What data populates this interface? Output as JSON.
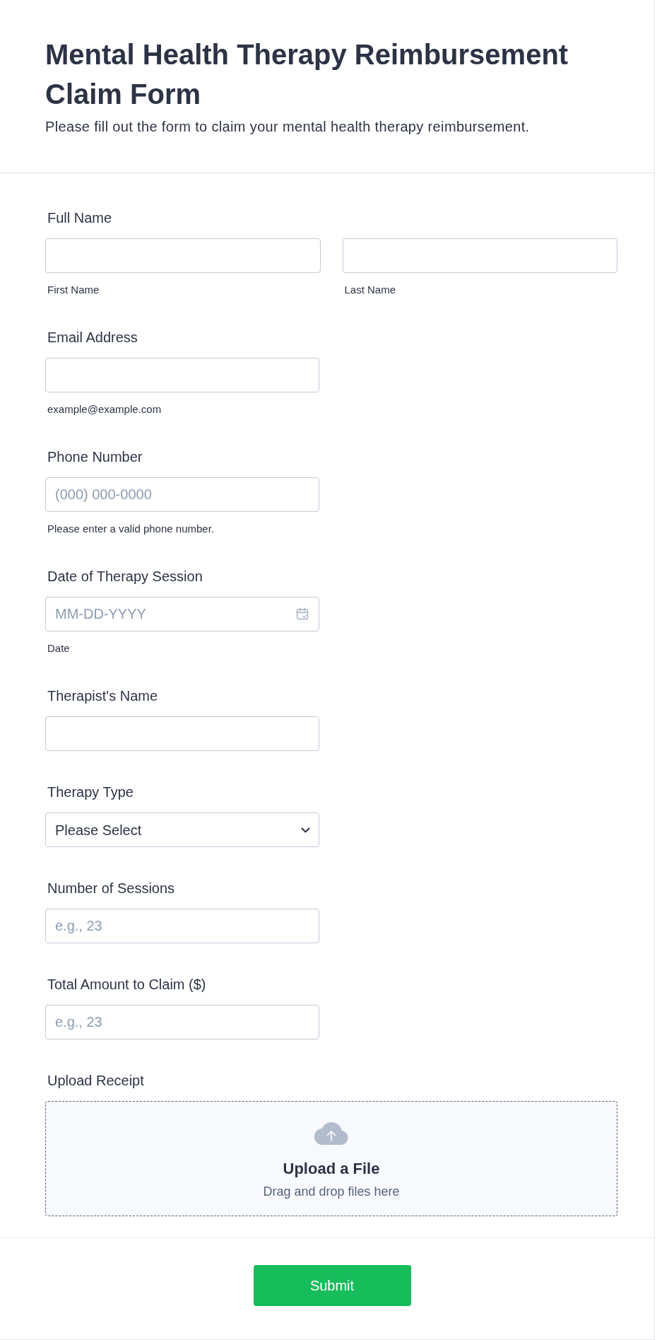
{
  "form": {
    "title": "Mental Health Therapy Reimbursement Claim Form",
    "subtitle": "Please fill out the form to claim your mental health therapy reimbursement."
  },
  "fields": [
    {
      "kind": "name",
      "label": "Full Name",
      "parts": [
        {
          "sublabel": "First Name"
        },
        {
          "sublabel": "Last Name"
        }
      ]
    },
    {
      "kind": "text",
      "label": "Email Address",
      "hint": "example@example.com"
    },
    {
      "kind": "text",
      "label": "Phone Number",
      "placeholder": "(000) 000-0000",
      "hint": "Please enter a valid phone number."
    },
    {
      "kind": "date",
      "label": "Date of Therapy Session",
      "placeholder": "MM-DD-YYYY",
      "hint": "Date"
    },
    {
      "kind": "text",
      "label": "Therapist's Name"
    },
    {
      "kind": "select",
      "label": "Therapy Type",
      "value": "Please Select"
    },
    {
      "kind": "text",
      "label": "Number of Sessions",
      "placeholder": "e.g., 23"
    },
    {
      "kind": "text",
      "label": "Total Amount to Claim ($)",
      "placeholder": "e.g., 23"
    },
    {
      "kind": "upload",
      "label": "Upload Receipt",
      "title": "Upload a File",
      "note": "Drag and drop files here"
    }
  ],
  "submit": "Submit"
}
